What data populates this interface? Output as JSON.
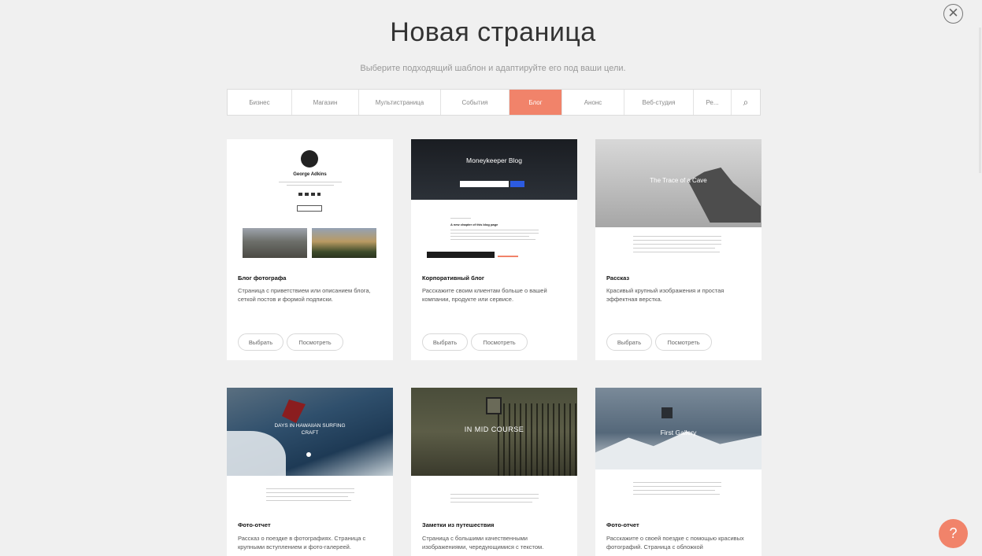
{
  "header": {
    "title": "Новая страница",
    "subtitle": "Выберите подходящий шаблон и адаптируйте его под ваши цели."
  },
  "tabs": [
    "Бизнес",
    "Магазин",
    "Мультистраница",
    "События",
    "Блог",
    "Анонс",
    "Веб-студия",
    "Ре..."
  ],
  "active_tab_index": 4,
  "colors": {
    "accent": "#f1836a",
    "background": "#f0f0f0"
  },
  "cards": [
    {
      "title": "Блог фотографа",
      "description": "Страница с приветствием или описанием блога, сеткой постов и формой подписки.",
      "preview": {
        "author_name": "George Adkins"
      }
    },
    {
      "title": "Корпоративный блог",
      "description": "Расскажите своим клиентам больше о вашей компании, продукте или сервисе.",
      "preview": {
        "heading": "Moneykeeper Blog",
        "post_title": "A new chapter of this blog page"
      }
    },
    {
      "title": "Рассказ",
      "description": "Красивый крупный изображения и простая эффектная верстка.",
      "preview": {
        "heading": "The Trace of a Cave"
      }
    },
    {
      "title": "Фото-отчет",
      "description": "Рассказ о поездке в фотографиях. Страница с крупными вступлением и фото-галереей.",
      "preview": {
        "heading": "DAYS IN HAWAIIAN SURFING CRAFT"
      }
    },
    {
      "title": "Заметки из путешествия",
      "description": "Страница с большими качественными изображениями, чередующимися с текстом.",
      "preview": {
        "heading": "IN MID COURSE"
      }
    },
    {
      "title": "Фото-отчет",
      "description": "Расскажите о своей поездке с помощью красивых фотографий. Страница с обложкой",
      "preview": {
        "heading": "First Gallery"
      }
    }
  ],
  "card_buttons": {
    "select": "Выбрать",
    "preview": "Посмотреть"
  },
  "icons": {
    "close": "close-icon",
    "search": "search-icon",
    "help": "help-icon"
  },
  "help_label": "?"
}
